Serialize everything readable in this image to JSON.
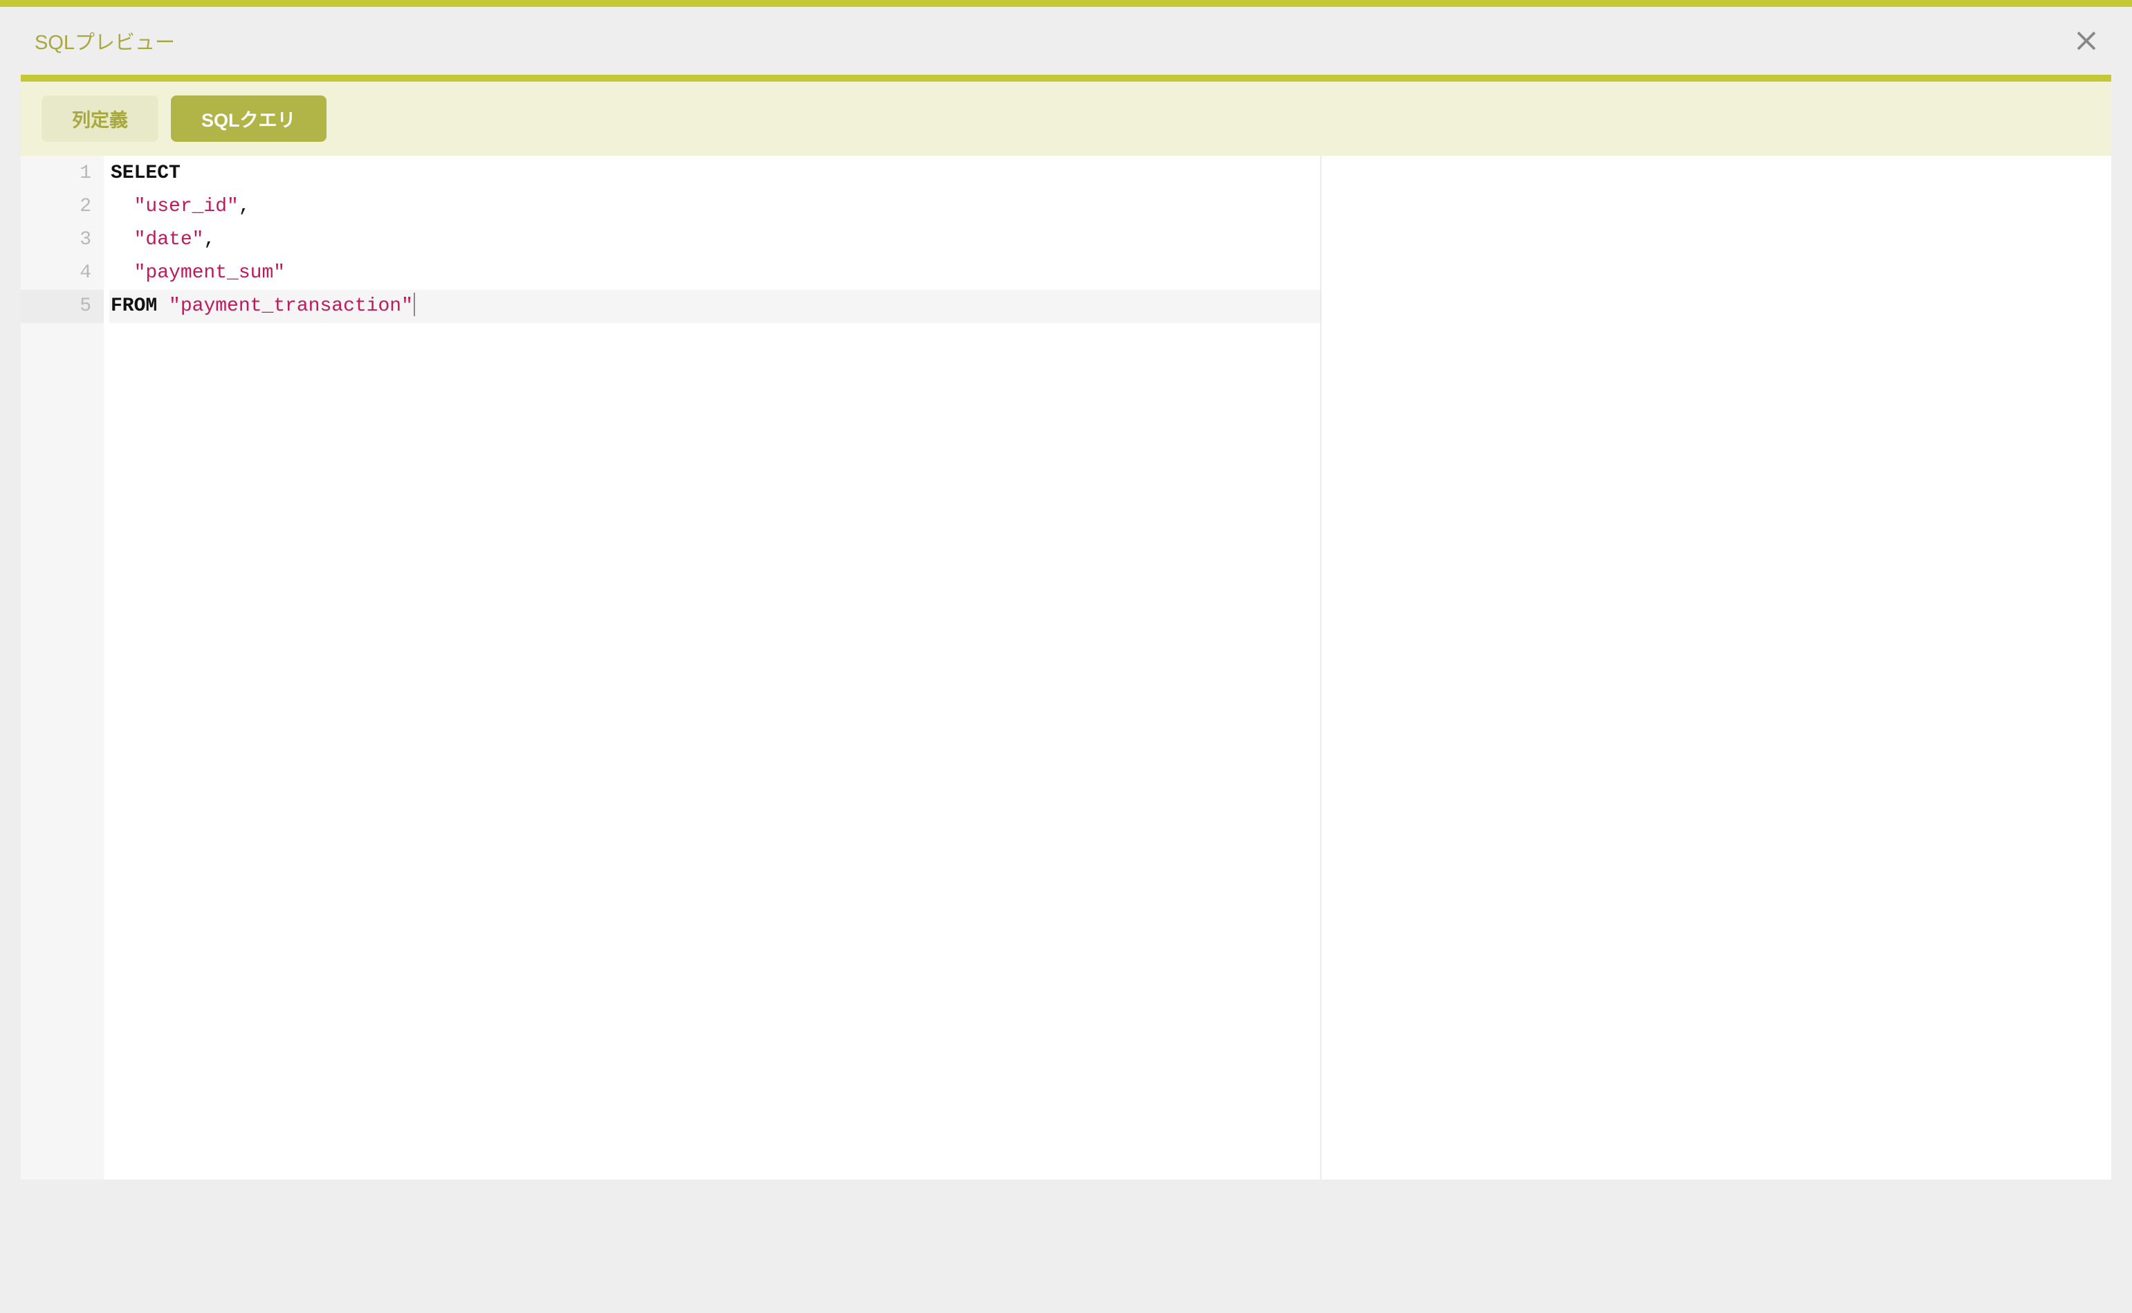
{
  "header": {
    "title": "SQLプレビュー"
  },
  "tabs": {
    "column_def_label": "列定義",
    "sql_query_label": "SQLクエリ"
  },
  "editor": {
    "line_numbers": [
      "1",
      "2",
      "3",
      "4",
      "5"
    ],
    "lines": [
      {
        "tokens": [
          {
            "t": "SELECT",
            "cls": "tok-keyword"
          }
        ]
      },
      {
        "tokens": [
          {
            "t": "  ",
            "cls": "tok-plain"
          },
          {
            "t": "\"user_id\"",
            "cls": "tok-string"
          },
          {
            "t": ",",
            "cls": "tok-plain"
          }
        ]
      },
      {
        "tokens": [
          {
            "t": "  ",
            "cls": "tok-plain"
          },
          {
            "t": "\"date\"",
            "cls": "tok-string"
          },
          {
            "t": ",",
            "cls": "tok-plain"
          }
        ]
      },
      {
        "tokens": [
          {
            "t": "  ",
            "cls": "tok-plain"
          },
          {
            "t": "\"payment_sum\"",
            "cls": "tok-string"
          }
        ]
      },
      {
        "tokens": [
          {
            "t": "FROM",
            "cls": "tok-keyword"
          },
          {
            "t": " ",
            "cls": "tok-plain"
          },
          {
            "t": "\"payment_transaction\"",
            "cls": "tok-string"
          }
        ],
        "active": true,
        "cursor": true
      }
    ]
  }
}
